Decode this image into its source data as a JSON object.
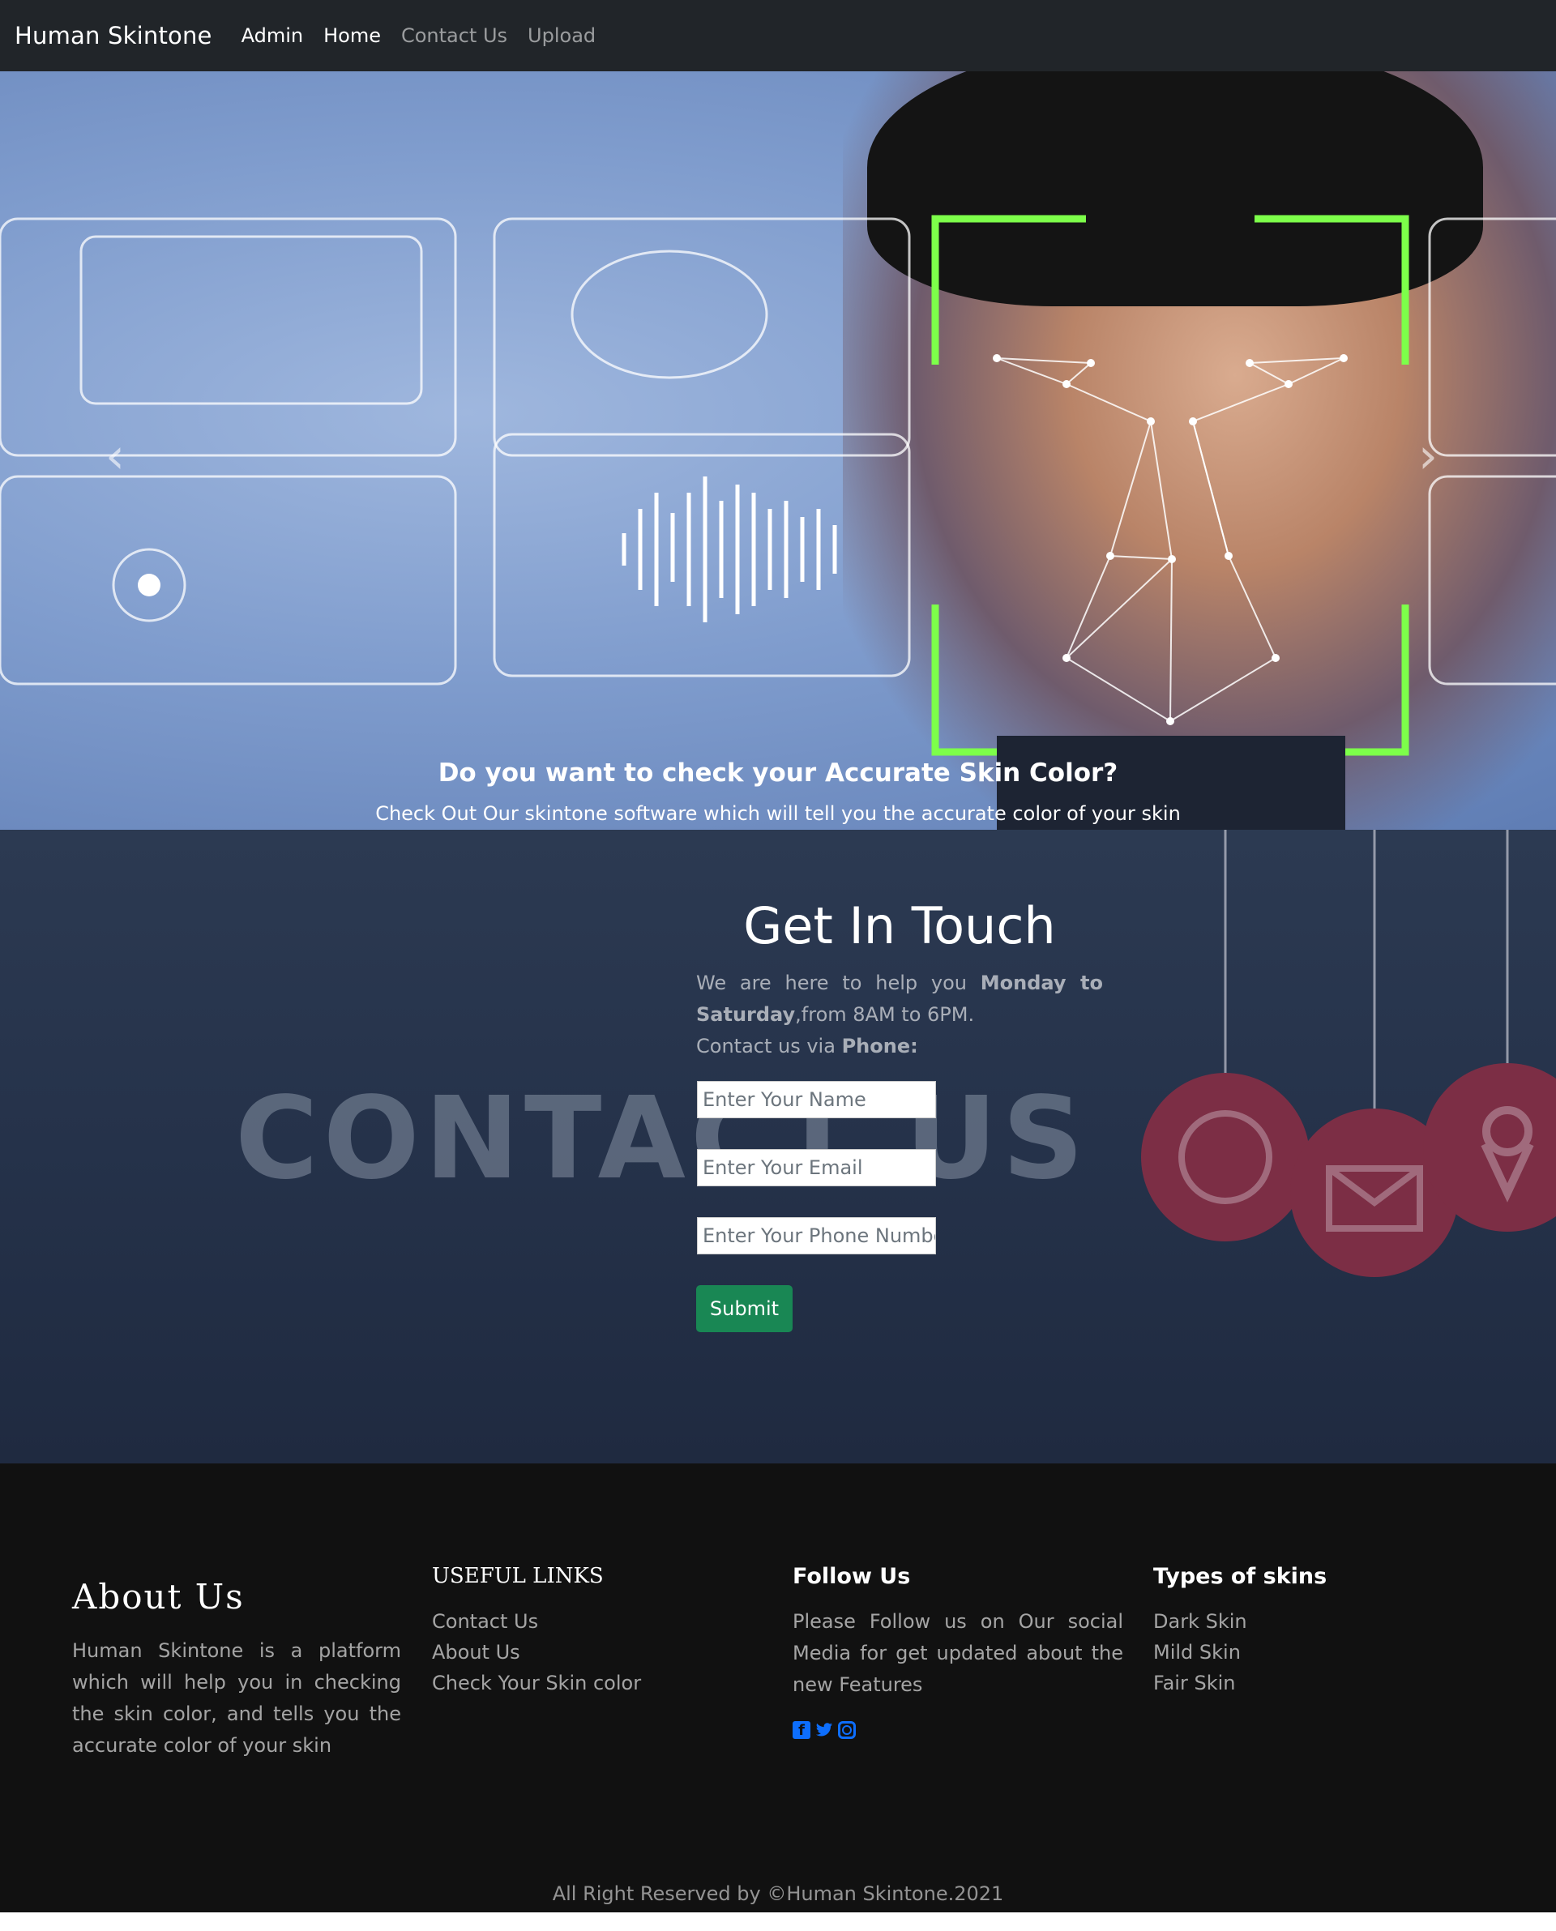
{
  "navbar": {
    "brand": "Human Skintone",
    "links": [
      "Admin",
      "Home",
      "Contact Us",
      "Upload"
    ]
  },
  "hero": {
    "caption_title": "Do you want to check your Accurate Skin Color?",
    "caption_text": "Check Out Our skintone software which will tell you the accurate color of your skin",
    "active_slide": 3,
    "slide_count": 3
  },
  "contact": {
    "watermark": "CONTACT US",
    "title": "Get In Touch",
    "desc_prefix": "We are here to help you ",
    "desc_days_1": "Monday to",
    "desc_days_2": "Saturday",
    "desc_suffix": ",from 8AM to 6PM.",
    "phone_prefix": "Contact us via ",
    "phone_label": "Phone:",
    "name_placeholder": "Enter Your Name",
    "email_placeholder": "Enter Your Email",
    "phone_placeholder": "Enter Your Phone Number",
    "submit_label": "Submit"
  },
  "footer": {
    "about_title": "About Us",
    "about_text": "Human Skintone is a platform which will help you in checking the skin color, and tells you the accurate color of your skin",
    "useful_links_title": "USEFUL LINKS",
    "useful_links": [
      "Contact Us",
      "About Us",
      "Check Your Skin color"
    ],
    "follow_title": "Follow Us",
    "follow_text": "Please Follow us on Our social Media for get updated about the new Features",
    "social_icons": [
      "facebook-icon",
      "twitter-icon",
      "instagram-icon"
    ],
    "skins_title": "Types of skins",
    "skins": [
      "Dark Skin",
      "Mild Skin",
      "Fair Skin"
    ],
    "copyright": "All Right Reserved by ©Human Skintone.2021"
  },
  "colors": {
    "navbar_bg": "#212529",
    "submit_bg": "#198754",
    "footer_bg": "#111111",
    "social_icon": "#0d6efd",
    "face_frame": "#7dff4a"
  }
}
